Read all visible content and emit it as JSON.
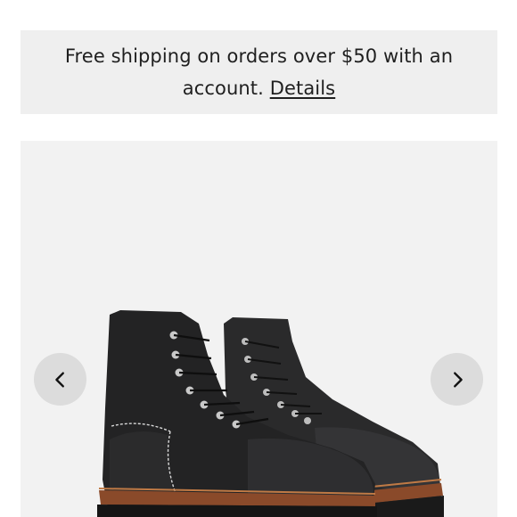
{
  "promo": {
    "message": "Free shipping on orders over $50 with an account.",
    "link_label": "Details"
  },
  "gallery": {
    "prev_icon": "chevron-left-icon",
    "next_icon": "chevron-right-icon",
    "product": "black leather lace-up boots"
  },
  "colors": {
    "banner_bg": "#efefef",
    "gallery_bg": "#f2f2f2",
    "nav_button_bg": "#dcdcdc",
    "text": "#1f1f1f"
  }
}
